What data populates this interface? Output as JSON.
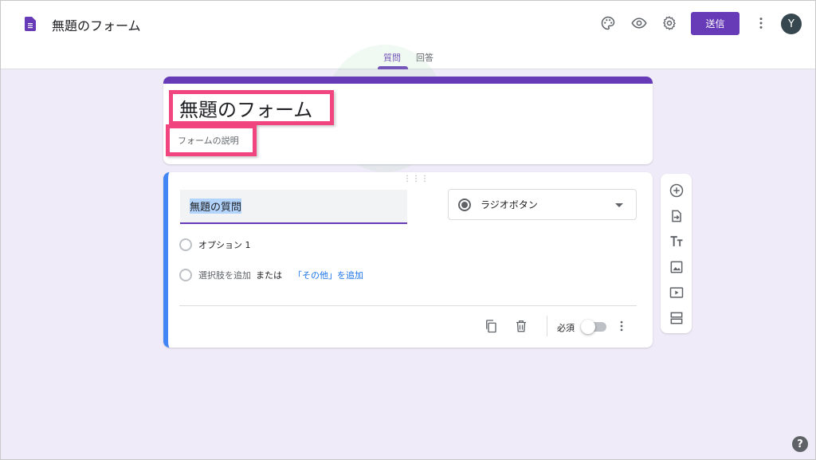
{
  "app": {
    "doc_title": "無題のフォーム",
    "send_label": "送信",
    "avatar_letter": "Y"
  },
  "tabs": [
    {
      "label": "質問",
      "active": true
    },
    {
      "label": "回答",
      "active": false
    }
  ],
  "form": {
    "title": "無題のフォーム",
    "description": "フォームの説明"
  },
  "question": {
    "title": "無題の質問",
    "type": "ラジオボタン",
    "options": [
      "オプション 1"
    ],
    "add_option": "選択肢を追加",
    "or_text": "または",
    "add_other": "「その他」を追加",
    "required_label": "必須",
    "required": false
  },
  "icons": {
    "header": [
      "palette-icon",
      "preview-eye-icon",
      "settings-gear-icon",
      "more-vert-icon"
    ],
    "sidebar": [
      "add-question-icon",
      "import-questions-icon",
      "add-title-icon",
      "add-image-icon",
      "add-video-icon",
      "add-section-icon"
    ],
    "footer": [
      "duplicate-icon",
      "delete-icon",
      "more-vert-icon"
    ],
    "help": "help-icon"
  },
  "colors": {
    "accent": "#673ab7",
    "background": "#f0ebf8",
    "focus_border": "#4285f4",
    "annotation": "#f0457f",
    "link": "#1a73e8"
  },
  "help_label": "?"
}
